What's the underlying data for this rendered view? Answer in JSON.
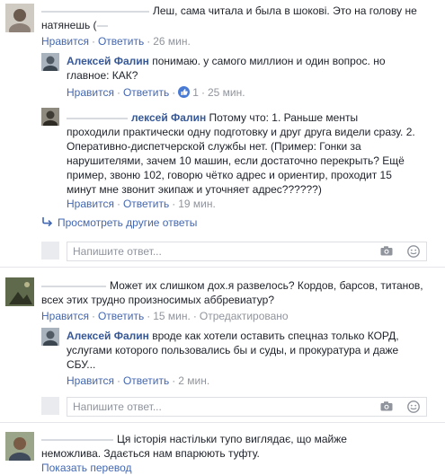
{
  "thread1": {
    "comment": {
      "line1": "Леш, сама читала и была в шокові. Это на голову не",
      "line2": "натянешь (",
      "like": "Нравится",
      "reply": "Ответить",
      "time": "26 мин."
    },
    "reply1": {
      "author": "Алексей Фалин",
      "line1": " понимаю. у самого миллион и один вопрос. но",
      "line2": "главное: КАК?",
      "like": "Нравится",
      "reply": "Ответить",
      "likes_count": "1",
      "time": "25 мин."
    },
    "reply2": {
      "author_partial": "лексей Фалин",
      "line1": " Потому что: 1. Раньше менты",
      "line2": "проходили практически одну подготовку и друг друга видели сразу. 2.",
      "line3": "Оперативно-диспетчерской службы нет. (Пример: Гонки за",
      "line4": "нарушителями, зачем 10 машин, если достаточно перекрыть? Ещё",
      "line5": "пример, звоню 102, говорю чётко адрес и ориентир, проходит 15",
      "line6": "минут мне звонит экипаж и уточняет адрес??????)",
      "like": "Нравится",
      "reply": "Ответить",
      "time": "19 мин."
    },
    "more_replies": "Просмотреть другие ответы",
    "reply_placeholder": "Напишите ответ..."
  },
  "thread2": {
    "comment": {
      "line1": "Может их слишком дох.я развелось? Кордов, барсов, титанов,",
      "line2": "всех этих трудно произносимых аббревиатур?",
      "like": "Нравится",
      "reply": "Ответить",
      "time": "15 мин.",
      "edited": "Отредактировано"
    },
    "reply1": {
      "author": "Алексей Фалин",
      "line1": " вроде как хотели оставить спецназ только КОРД,",
      "line2": "услугами которого пользовались бы и суды, и прокуратура и даже",
      "line3": "СБУ...",
      "like": "Нравится",
      "reply": "Ответить",
      "time": "2 мин."
    },
    "reply_placeholder": "Напишите ответ..."
  },
  "thread3": {
    "comment": {
      "line1": "Ця історія настільки тупо виглядає, що майже",
      "line2": "неможлива. Здається нам впарюють туфту.",
      "translate": "Показать перевод"
    }
  },
  "colors": {
    "link": "#4267b2",
    "name": "#365899",
    "meta": "#90949c",
    "text": "#1d2129",
    "like_badge": "#4a7bd4"
  },
  "icons": [
    "reply-arrow-icon",
    "camera-icon",
    "smiley-icon",
    "like-thumb-icon"
  ]
}
